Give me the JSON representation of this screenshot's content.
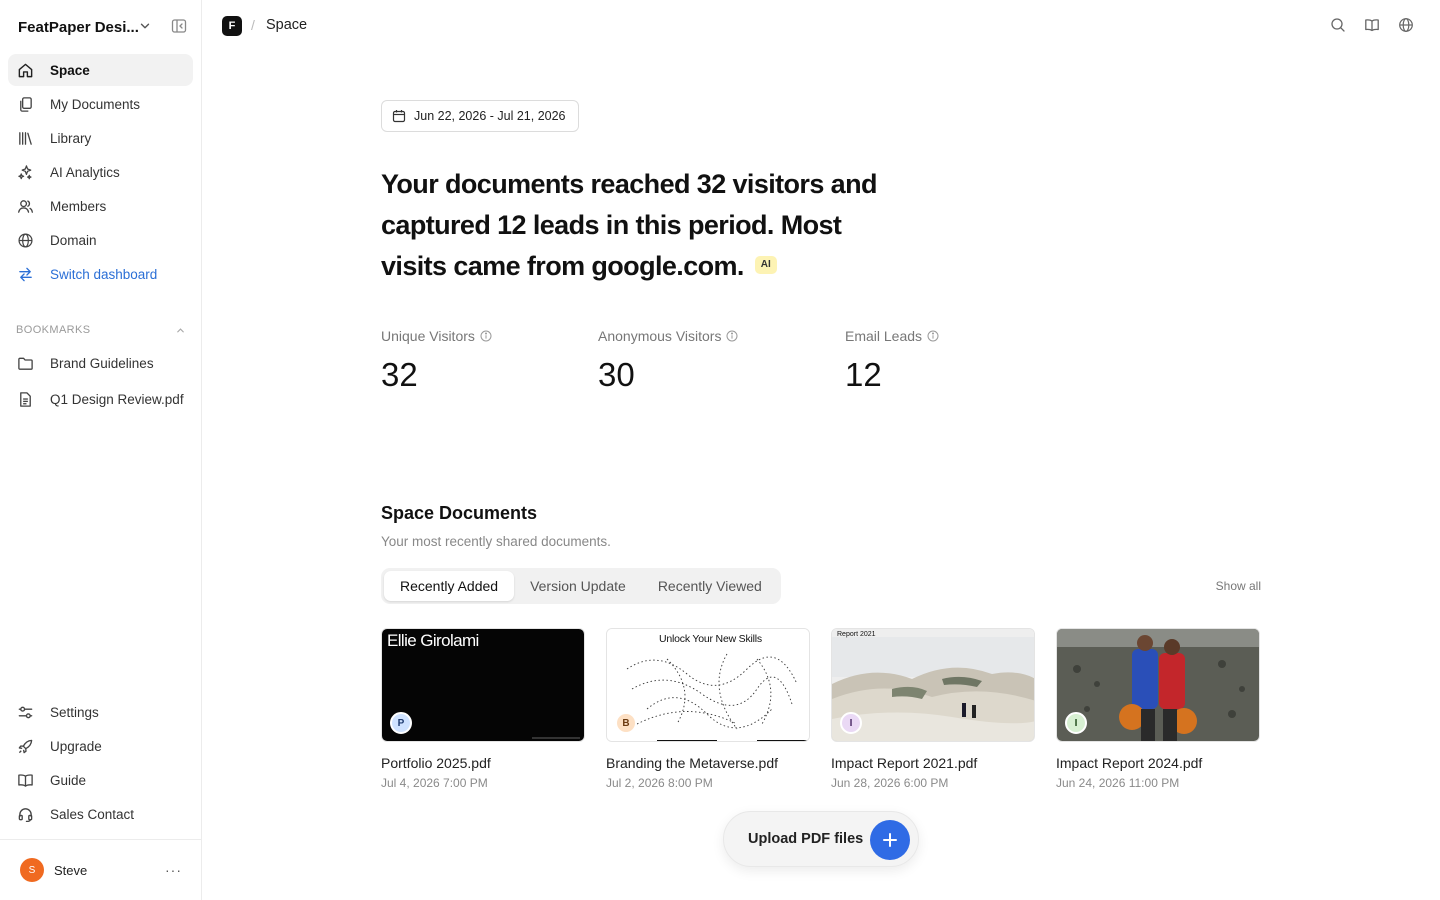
{
  "workspace": {
    "name": "FeatPaper Desi..."
  },
  "nav": [
    {
      "label": "Space",
      "icon": "home-icon"
    },
    {
      "label": "My Documents",
      "icon": "documents-icon"
    },
    {
      "label": "Library",
      "icon": "library-icon"
    },
    {
      "label": "AI Analytics",
      "icon": "sparkles-icon"
    },
    {
      "label": "Members",
      "icon": "members-icon"
    },
    {
      "label": "Domain",
      "icon": "globe-icon"
    },
    {
      "label": "Switch dashboard",
      "icon": "switch-icon"
    }
  ],
  "bookmarks": {
    "title": "BOOKMARKS",
    "items": [
      {
        "label": "Brand Guidelines",
        "icon": "folder-icon"
      },
      {
        "label": "Q1 Design Review.pdf",
        "icon": "file-icon"
      }
    ]
  },
  "bottom_nav": [
    {
      "label": "Settings",
      "icon": "settings-icon"
    },
    {
      "label": "Upgrade",
      "icon": "rocket-icon"
    },
    {
      "label": "Guide",
      "icon": "book-icon"
    },
    {
      "label": "Sales Contact",
      "icon": "headset-icon"
    }
  ],
  "user": {
    "initial": "S",
    "name": "Steve",
    "more": "···"
  },
  "topbar": {
    "brand_initial": "F",
    "separator": "/",
    "crumb": "Space"
  },
  "date_range": "Jun 22, 2026 - Jul 21, 2026",
  "headline": "Your documents reached 32 visitors and captured 12 leads in this period. Most visits came from google.com.",
  "ai_badge": "AI",
  "stats": [
    {
      "label": "Unique Visitors",
      "value": "32"
    },
    {
      "label": "Anonymous Visitors",
      "value": "30"
    },
    {
      "label": "Email Leads",
      "value": "12"
    }
  ],
  "space_documents": {
    "title": "Space Documents",
    "subtitle": "Your most recently shared documents.",
    "tabs": [
      "Recently Added",
      "Version Update",
      "Recently Viewed"
    ],
    "show_all": "Show all",
    "docs": [
      {
        "name": "Portfolio 2025.pdf",
        "date": "Jul 4, 2026 7:00 PM",
        "avatar": "P",
        "avatar_color": "#cfe2ff",
        "thumb_text": "Ellie Girolami"
      },
      {
        "name": "Branding the Metaverse.pdf",
        "date": "Jul 2, 2026 8:00 PM",
        "avatar": "B",
        "avatar_color": "#fde0c4",
        "thumb_text": "Unlock Your New Skills"
      },
      {
        "name": "Impact Report 2021.pdf",
        "date": "Jun 28, 2026 6:00 PM",
        "avatar": "I",
        "avatar_color": "#ead9f5",
        "thumb_text": "Report 2021"
      },
      {
        "name": "Impact Report 2024.pdf",
        "date": "Jun 24, 2026 11:00 PM",
        "avatar": "I",
        "avatar_color": "#d7f0d2",
        "thumb_text": ""
      }
    ]
  },
  "upload": {
    "label": "Upload PDF files"
  },
  "colors": {
    "accent": "#2b6fd6",
    "upload_button": "#2f6be5",
    "ai_badge": "#fdf3b4"
  }
}
